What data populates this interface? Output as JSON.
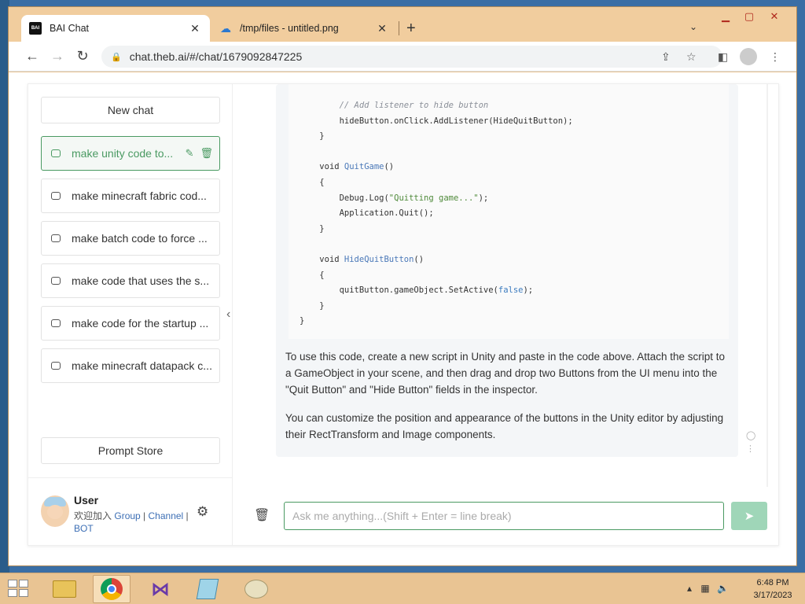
{
  "browser": {
    "tabs": [
      {
        "title": "BAI Chat",
        "favicon": "bai-icon",
        "favicon_text": "BAI",
        "active": true
      },
      {
        "title": "/tmp/files - untitled.png",
        "favicon": "cloud-icon",
        "active": false
      }
    ],
    "new_tab_label": "+",
    "url": "chat.theb.ai/#/chat/1679092847225"
  },
  "sidebar": {
    "new_chat": "New chat",
    "chats": [
      {
        "label": "make unity code to...",
        "active": true
      },
      {
        "label": "make minecraft fabric cod..."
      },
      {
        "label": "make batch code to force ..."
      },
      {
        "label": "make code that uses the s..."
      },
      {
        "label": "make code for the startup ..."
      },
      {
        "label": "make minecraft datapack c..."
      }
    ],
    "prompt_store": "Prompt Store",
    "user": {
      "name": "User",
      "welcome": "欢迎加入",
      "links": [
        "Group",
        "Channel",
        "BOT"
      ]
    }
  },
  "message": {
    "code_lines": [
      {
        "indent": "        ",
        "parts": [
          [
            "c-com",
            "// Add listener to hide button"
          ]
        ]
      },
      {
        "indent": "        ",
        "parts": [
          [
            "",
            "hideButton.onClick.AddListener(HideQuitButton);"
          ]
        ]
      },
      {
        "indent": "    ",
        "parts": [
          [
            "",
            "}"
          ]
        ]
      },
      {
        "indent": "",
        "parts": [
          [
            "",
            ""
          ]
        ]
      },
      {
        "indent": "    ",
        "parts": [
          [
            "",
            "void "
          ],
          [
            "c-fn",
            "QuitGame"
          ],
          [
            "",
            "()"
          ]
        ]
      },
      {
        "indent": "    ",
        "parts": [
          [
            "",
            "{"
          ]
        ]
      },
      {
        "indent": "        ",
        "parts": [
          [
            "",
            "Debug.Log("
          ],
          [
            "c-str",
            "\"Quitting game...\""
          ],
          [
            "",
            ");"
          ]
        ]
      },
      {
        "indent": "        ",
        "parts": [
          [
            "",
            "Application.Quit();"
          ]
        ]
      },
      {
        "indent": "    ",
        "parts": [
          [
            "",
            "}"
          ]
        ]
      },
      {
        "indent": "",
        "parts": [
          [
            "",
            ""
          ]
        ]
      },
      {
        "indent": "    ",
        "parts": [
          [
            "",
            "void "
          ],
          [
            "c-fn",
            "HideQuitButton"
          ],
          [
            "",
            "()"
          ]
        ]
      },
      {
        "indent": "    ",
        "parts": [
          [
            "",
            "{"
          ]
        ]
      },
      {
        "indent": "        ",
        "parts": [
          [
            "",
            "quitButton.gameObject.SetActive("
          ],
          [
            "c-kw",
            "false"
          ],
          [
            "",
            ");"
          ]
        ]
      },
      {
        "indent": "    ",
        "parts": [
          [
            "",
            "}"
          ]
        ]
      },
      {
        "indent": "",
        "parts": [
          [
            "",
            "}"
          ]
        ]
      }
    ],
    "paragraph_1": "To use this code, create a new script in Unity and paste in the code above. Attach the script to a GameObject in your scene, and then drag and drop two Buttons from the UI menu into the \"Quit Button\" and \"Hide Button\" fields in the inspector.",
    "paragraph_2": "You can customize the position and appearance of the buttons in the Unity editor by adjusting their RectTransform and Image components."
  },
  "input": {
    "value": "",
    "placeholder": "Ask me anything...(Shift + Enter = line break)"
  },
  "taskbar": {
    "apps": [
      "file-explorer-icon",
      "chrome-icon",
      "visual-studio-icon",
      "notepad-icon",
      "paint-icon"
    ],
    "time": "6:48 PM",
    "date": "3/17/2023"
  },
  "colors": {
    "accent": "#4a9a62",
    "send_button": "#9fd6b8",
    "link": "#3d6fb5",
    "titlebar": "#f1cd9e"
  }
}
